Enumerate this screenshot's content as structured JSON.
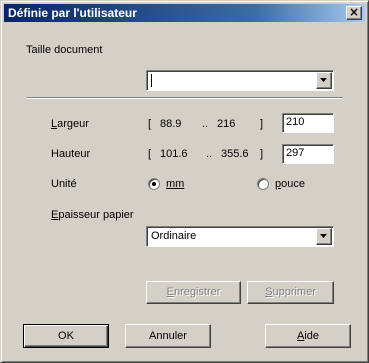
{
  "window": {
    "title": "Définie par l'utilisateur",
    "close_glyph": "×",
    "close_icon": "close-icon"
  },
  "size_group": {
    "label": "Taille document",
    "selected_value": ""
  },
  "width": {
    "label": "Largeur",
    "range_open": "[",
    "min": "88.9",
    "dots": "..",
    "max": "216",
    "range_close": "]",
    "value": "210"
  },
  "height": {
    "label": "Hauteur",
    "range_open": "[",
    "min": "101.6",
    "dots": "..",
    "max": "355.6",
    "range_close": "]",
    "value": "297"
  },
  "unit": {
    "label": "Unité",
    "options": [
      {
        "label": "mm",
        "selected": true
      },
      {
        "label": "pouce",
        "selected": false
      }
    ]
  },
  "paper": {
    "label": "Epaisseur papier",
    "selected_value": "Ordinaire"
  },
  "actions": {
    "save": "Enregistrer",
    "delete": "Supprimer",
    "ok": "OK",
    "cancel": "Annuler",
    "help": "Aide"
  }
}
